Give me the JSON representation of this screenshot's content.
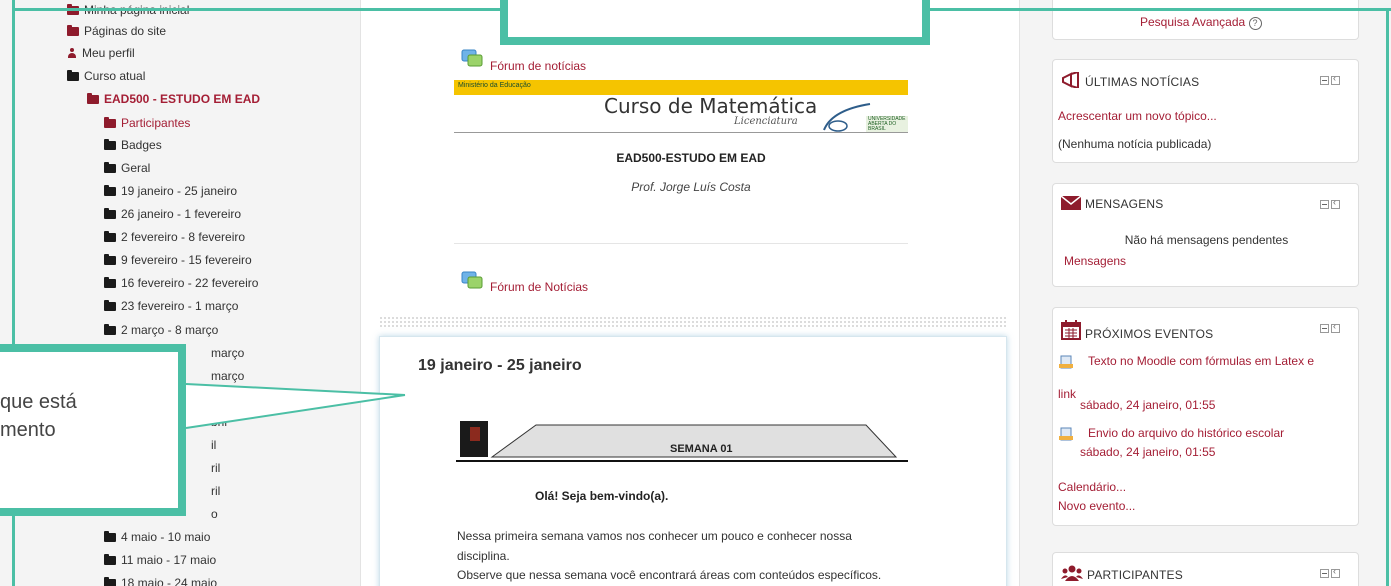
{
  "left_nav": {
    "items": [
      {
        "label": "Minha página inicial",
        "icon": "folder-icon"
      },
      {
        "label": "Páginas do site",
        "icon": "folder-icon"
      },
      {
        "label": "Meu perfil",
        "icon": "user-icon"
      },
      {
        "label": "Curso atual",
        "icon": "folder-open-icon"
      },
      {
        "label": "EAD500 - ESTUDO EM EAD",
        "icon": "folder-open-icon"
      },
      {
        "label": "Participantes",
        "icon": "folder-icon"
      },
      {
        "label": "Badges",
        "icon": "folder-icon"
      },
      {
        "label": "Geral",
        "icon": "folder-icon"
      },
      {
        "label": "19 janeiro - 25 janeiro",
        "icon": "folder-icon"
      },
      {
        "label": "26 janeiro - 1 fevereiro",
        "icon": "folder-icon"
      },
      {
        "label": "2 fevereiro - 8 fevereiro",
        "icon": "folder-icon"
      },
      {
        "label": "9 fevereiro - 15 fevereiro",
        "icon": "folder-icon"
      },
      {
        "label": "16 fevereiro - 22 fevereiro",
        "icon": "folder-icon"
      },
      {
        "label": "23 fevereiro - 1 março",
        "icon": "folder-icon"
      },
      {
        "label": "2 março - 8 março",
        "icon": "folder-icon"
      },
      {
        "label": "março",
        "icon": "folder-icon"
      },
      {
        "label": "março",
        "icon": "folder-icon"
      },
      {
        "label": "março",
        "icon": "folder-icon"
      },
      {
        "label": "bril",
        "icon": "folder-icon"
      },
      {
        "label": "il",
        "icon": "folder-icon"
      },
      {
        "label": "ril",
        "icon": "folder-icon"
      },
      {
        "label": "ril",
        "icon": "folder-icon"
      },
      {
        "label": "o",
        "icon": "folder-icon"
      },
      {
        "label": "4 maio - 10 maio",
        "icon": "folder-icon"
      },
      {
        "label": "11 maio - 17 maio",
        "icon": "folder-icon"
      },
      {
        "label": "18 maio - 24 maio",
        "icon": "folder-icon"
      }
    ]
  },
  "main": {
    "forum_news_top": "Fórum de notícias",
    "banner": {
      "ministry": "Ministério da Educação",
      "title": "Curso de Matemática",
      "subtitle": "Licenciatura",
      "university": "UNIVERSIDADE ABERTA DO BRASIL"
    },
    "course_name": "EAD500-ESTUDO EM EAD",
    "professor": "Prof. Jorge Luís Costa",
    "forum_news_bottom": "Fórum de Notícias",
    "section": {
      "title": "19 janeiro - 25 janeiro",
      "week_banner": "SEMANA 01",
      "welcome": "Olá! Seja bem-vindo(a).",
      "paragraph_line1": "Nessa primeira semana vamos nos conhecer um pouco e conhecer nossa",
      "paragraph_line2": "disciplina.",
      "paragraph_line3": "Observe que nessa semana você encontrará áreas com conteúdos específicos."
    }
  },
  "right_col": {
    "advanced_search": "Pesquisa Avançada",
    "news": {
      "title": "ÚLTIMAS NOTÍCIAS",
      "add_topic": "Acrescentar um novo tópico...",
      "empty": "(Nenhuma notícia publicada)"
    },
    "messages": {
      "title": "MENSAGENS",
      "empty": "Não há mensagens pendentes",
      "link": "Mensagens"
    },
    "events": {
      "title": "PRÓXIMOS EVENTOS",
      "event1_line1": "Texto no Moodle com fórmulas em Latex e",
      "event1_line2": "link",
      "event1_date": "sábado, 24 janeiro, 01:55",
      "event2_title": "Envio do arquivo do histórico escolar",
      "event2_date": "sábado, 24 janeiro, 01:55",
      "calendar": "Calendário...",
      "new_event": "Novo evento..."
    },
    "participants": {
      "title": "PARTICIPANTES"
    }
  },
  "callout": {
    "line1": "que está",
    "line2": "mento"
  },
  "colors": {
    "accent_teal": "#4bbfa5",
    "link_red": "#a41e35",
    "folder_red": "#8e1b2c"
  }
}
